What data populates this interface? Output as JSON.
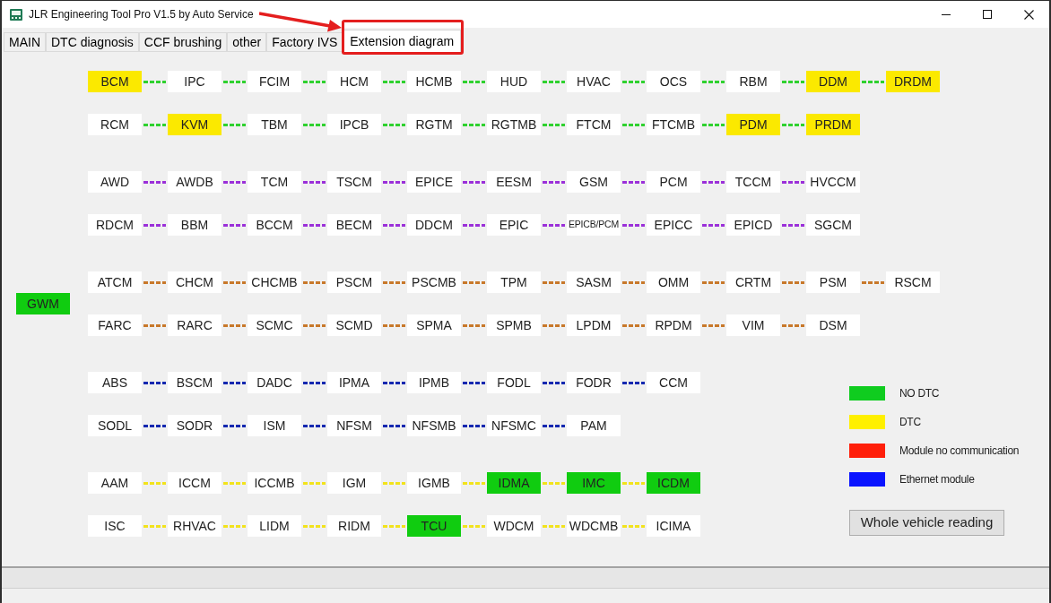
{
  "window": {
    "title": "JLR Engineering Tool Pro V1.5 by Auto Service"
  },
  "tabs": [
    {
      "label": "MAIN",
      "selected": false,
      "highlighted": false
    },
    {
      "label": "DTC diagnosis",
      "selected": false,
      "highlighted": false
    },
    {
      "label": "CCF brushing",
      "selected": false,
      "highlighted": false
    },
    {
      "label": "other",
      "selected": false,
      "highlighted": false
    },
    {
      "label": "Factory IVS",
      "selected": false,
      "highlighted": false
    },
    {
      "label": "Extension diagram",
      "selected": true,
      "highlighted": true
    }
  ],
  "gateway": {
    "name": "GWM",
    "color": "#10cc10"
  },
  "groups": [
    {
      "color": "#2fd12f",
      "rows": [
        {
          "modules": [
            {
              "name": "BCM",
              "color": "#fbe900"
            },
            {
              "name": "IPC",
              "color": "#ffffff"
            },
            {
              "name": "FCIM",
              "color": "#ffffff"
            },
            {
              "name": "HCM",
              "color": "#ffffff"
            },
            {
              "name": "HCMB",
              "color": "#ffffff"
            },
            {
              "name": "HUD",
              "color": "#ffffff"
            },
            {
              "name": "HVAC",
              "color": "#ffffff"
            },
            {
              "name": "OCS",
              "color": "#ffffff"
            },
            {
              "name": "RBM",
              "color": "#ffffff"
            },
            {
              "name": "DDM",
              "color": "#fbe900"
            },
            {
              "name": "DRDM",
              "color": "#fbe900"
            }
          ]
        },
        {
          "modules": [
            {
              "name": "RCM",
              "color": "#ffffff"
            },
            {
              "name": "KVM",
              "color": "#fbe900"
            },
            {
              "name": "TBM",
              "color": "#ffffff"
            },
            {
              "name": "IPCB",
              "color": "#ffffff"
            },
            {
              "name": "RGTM",
              "color": "#ffffff"
            },
            {
              "name": "RGTMB",
              "color": "#ffffff"
            },
            {
              "name": "FTCM",
              "color": "#ffffff"
            },
            {
              "name": "FTCMB",
              "color": "#ffffff"
            },
            {
              "name": "PDM",
              "color": "#fbe900"
            },
            {
              "name": "PRDM",
              "color": "#fbe900"
            }
          ]
        }
      ]
    },
    {
      "color": "#9b30d9",
      "rows": [
        {
          "modules": [
            {
              "name": "AWD",
              "color": "#ffffff"
            },
            {
              "name": "AWDB",
              "color": "#ffffff"
            },
            {
              "name": "TCM",
              "color": "#ffffff"
            },
            {
              "name": "TSCM",
              "color": "#ffffff"
            },
            {
              "name": "EPICE",
              "color": "#ffffff"
            },
            {
              "name": "EESM",
              "color": "#ffffff"
            },
            {
              "name": "GSM",
              "color": "#ffffff"
            },
            {
              "name": "PCM",
              "color": "#ffffff"
            },
            {
              "name": "TCCM",
              "color": "#ffffff"
            },
            {
              "name": "HVCCM",
              "color": "#ffffff"
            }
          ]
        },
        {
          "modules": [
            {
              "name": "RDCM",
              "color": "#ffffff"
            },
            {
              "name": "BBM",
              "color": "#ffffff"
            },
            {
              "name": "BCCM",
              "color": "#ffffff"
            },
            {
              "name": "BECM",
              "color": "#ffffff"
            },
            {
              "name": "DDCM",
              "color": "#ffffff"
            },
            {
              "name": "EPIC",
              "color": "#ffffff"
            },
            {
              "name": "EPICB/PCM",
              "color": "#ffffff"
            },
            {
              "name": "EPICC",
              "color": "#ffffff"
            },
            {
              "name": "EPICD",
              "color": "#ffffff"
            },
            {
              "name": "SGCM",
              "color": "#ffffff"
            }
          ]
        }
      ]
    },
    {
      "color": "#c8782a",
      "rows": [
        {
          "modules": [
            {
              "name": "ATCM",
              "color": "#ffffff"
            },
            {
              "name": "CHCM",
              "color": "#ffffff"
            },
            {
              "name": "CHCMB",
              "color": "#ffffff"
            },
            {
              "name": "PSCM",
              "color": "#ffffff"
            },
            {
              "name": "PSCMB",
              "color": "#ffffff"
            },
            {
              "name": "TPM",
              "color": "#ffffff"
            },
            {
              "name": "SASM",
              "color": "#ffffff"
            },
            {
              "name": "OMM",
              "color": "#ffffff"
            },
            {
              "name": "CRTM",
              "color": "#ffffff"
            },
            {
              "name": "PSM",
              "color": "#ffffff"
            },
            {
              "name": "RSCM",
              "color": "#ffffff"
            }
          ]
        },
        {
          "modules": [
            {
              "name": "FARC",
              "color": "#ffffff"
            },
            {
              "name": "RARC",
              "color": "#ffffff"
            },
            {
              "name": "SCMC",
              "color": "#ffffff"
            },
            {
              "name": "SCMD",
              "color": "#ffffff"
            },
            {
              "name": "SPMA",
              "color": "#ffffff"
            },
            {
              "name": "SPMB",
              "color": "#ffffff"
            },
            {
              "name": "LPDM",
              "color": "#ffffff"
            },
            {
              "name": "RPDM",
              "color": "#ffffff"
            },
            {
              "name": "VIM",
              "color": "#ffffff"
            },
            {
              "name": "DSM",
              "color": "#ffffff"
            }
          ]
        }
      ]
    },
    {
      "color": "#1428b0",
      "rows": [
        {
          "modules": [
            {
              "name": "ABS",
              "color": "#ffffff"
            },
            {
              "name": "BSCM",
              "color": "#ffffff"
            },
            {
              "name": "DADC",
              "color": "#ffffff"
            },
            {
              "name": "IPMA",
              "color": "#ffffff"
            },
            {
              "name": "IPMB",
              "color": "#ffffff"
            },
            {
              "name": "FODL",
              "color": "#ffffff"
            },
            {
              "name": "FODR",
              "color": "#ffffff"
            },
            {
              "name": "CCM",
              "color": "#ffffff"
            }
          ]
        },
        {
          "modules": [
            {
              "name": "SODL",
              "color": "#ffffff"
            },
            {
              "name": "SODR",
              "color": "#ffffff"
            },
            {
              "name": "ISM",
              "color": "#ffffff"
            },
            {
              "name": "NFSM",
              "color": "#ffffff"
            },
            {
              "name": "NFSMB",
              "color": "#ffffff"
            },
            {
              "name": "NFSMC",
              "color": "#ffffff"
            },
            {
              "name": "PAM",
              "color": "#ffffff"
            }
          ]
        }
      ]
    },
    {
      "color": "#f2e31c",
      "rows": [
        {
          "modules": [
            {
              "name": "AAM",
              "color": "#ffffff"
            },
            {
              "name": "ICCM",
              "color": "#ffffff"
            },
            {
              "name": "ICCMB",
              "color": "#ffffff"
            },
            {
              "name": "IGM",
              "color": "#ffffff"
            },
            {
              "name": "IGMB",
              "color": "#ffffff"
            },
            {
              "name": "IDMA",
              "color": "#10cc10"
            },
            {
              "name": "IMC",
              "color": "#10cc10"
            },
            {
              "name": "ICDM",
              "color": "#10cc10"
            }
          ]
        },
        {
          "modules": [
            {
              "name": "ISC",
              "color": "#ffffff"
            },
            {
              "name": "RHVAC",
              "color": "#ffffff"
            },
            {
              "name": "LIDM",
              "color": "#ffffff"
            },
            {
              "name": "RIDM",
              "color": "#ffffff"
            },
            {
              "name": "TCU",
              "color": "#10cc10"
            },
            {
              "name": "WDCM",
              "color": "#ffffff"
            },
            {
              "name": "WDCMB",
              "color": "#ffffff"
            },
            {
              "name": "ICIMA",
              "color": "#ffffff"
            }
          ]
        }
      ]
    }
  ],
  "legend": [
    {
      "label": "NO DTC",
      "color": "#0fcc1f"
    },
    {
      "label": "DTC",
      "color": "#fff000"
    },
    {
      "label": "Module no communication",
      "color": "#ff1f0a"
    },
    {
      "label": "Ethernet module",
      "color": "#0a14ff"
    }
  ],
  "read_button": {
    "label": "Whole vehicle reading"
  }
}
